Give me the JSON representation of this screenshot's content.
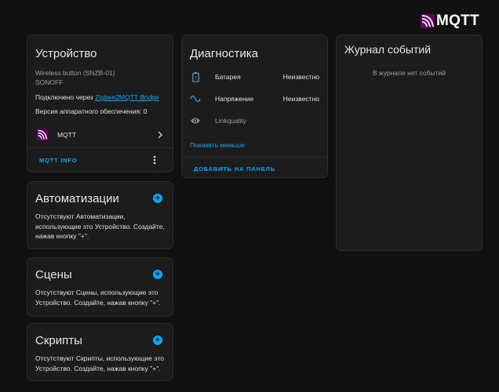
{
  "brand": {
    "name": "MQTT"
  },
  "device": {
    "title": "Устройство",
    "model": "Wireless button (SNZB-01)",
    "manufacturer": "SONOFF",
    "connected_prefix": "Подключено через ",
    "connected_link": "Zigbee2MQTT Bridge",
    "firmware": "Версия аппаратного обеспечения: 0",
    "integration": "MQTT",
    "info_button": "MQTT INFO"
  },
  "automations": {
    "title": "Автоматизации",
    "empty": "Отсутствуют Автоматизации, использующие это Устройство. Создайте, нажав кнопку \"+\"."
  },
  "scenes": {
    "title": "Сцены",
    "empty": "Отсутствуют Сцены, использующие это Устройство. Создайте, нажав кнопку \"+\"."
  },
  "scripts": {
    "title": "Скрипты",
    "empty": "Отсутствуют Скрипты, использующие это Устройство. Создайте, нажав кнопку \"+\"."
  },
  "diagnostics": {
    "title": "Диагностика",
    "rows": [
      {
        "name": "Батарея",
        "value": "Неизвестно",
        "icon": "battery-icon"
      },
      {
        "name": "Напряжение",
        "value": "Неизвестно",
        "icon": "sine-wave-icon"
      },
      {
        "name": "Linkquality",
        "value": "",
        "icon": "eye-icon"
      }
    ],
    "show_less": "Показать меньше",
    "add_to_dashboard": "ДОБАВИТЬ НА ПАНЕЛЬ"
  },
  "logbook": {
    "title": "Журнал событий",
    "empty": "В журнале нет событий"
  },
  "colors": {
    "accent": "#03a9f4",
    "background": "#111111",
    "card": "#1c1c1c",
    "mqtt_logo": "#660066"
  }
}
